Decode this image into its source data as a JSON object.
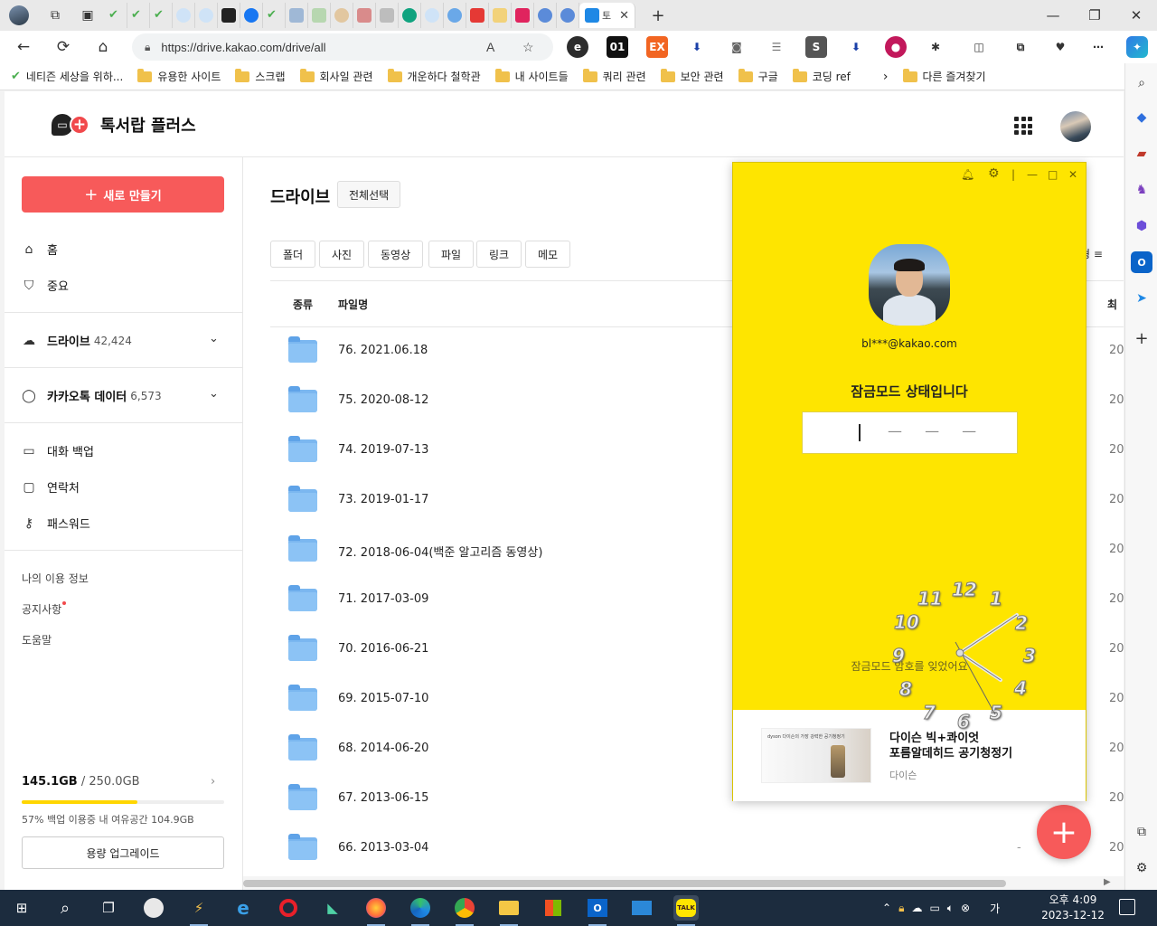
{
  "browser": {
    "active_tab_label": "토",
    "url": "https://drive.kakao.com/drive/all",
    "favorites": [
      "네티즌 세상을 위하...",
      "유용한 사이트",
      "스크랩",
      "회사일 관련",
      "개운하다 철학관",
      "내 사이트들",
      "쿼리 관련",
      "보안 관련",
      "구글",
      "코딩 ref"
    ],
    "other_favorites": "다른 즐겨찾기"
  },
  "header": {
    "logo_text": "톡서랍 플러스"
  },
  "sidebar": {
    "new_button": "새로 만들기",
    "home": "홈",
    "important": "중요",
    "drive": "드라이브",
    "drive_count": "42,424",
    "kakaotalk_data": "카카오톡 데이터",
    "kakaotalk_count": "6,573",
    "chat_backup": "대화 백업",
    "contacts": "연락처",
    "password": "패스워드",
    "my_usage": "나의 이용 정보",
    "notice": "공지사항",
    "help": "도움말",
    "storage_used": "145.1GB",
    "storage_total": "/ 250.0GB",
    "storage_fraction": 0.57,
    "storage_note": "57% 백업 이용중   내 여유공간 104.9GB",
    "upgrade_button": "용량 업그레이드"
  },
  "main": {
    "title": "드라이브",
    "select_all": "전체선택",
    "filters": [
      "폴더",
      "사진",
      "동영상",
      "파일",
      "링크",
      "메모"
    ],
    "sort_label": "형 ≡",
    "col_type": "종류",
    "col_name": "파일명",
    "col_right": "최",
    "rows": [
      {
        "name": "76. 2021.06.18",
        "date": "20"
      },
      {
        "name": "75. 2020-08-12",
        "date": "20"
      },
      {
        "name": "74. 2019-07-13",
        "date": "20"
      },
      {
        "name": "73. 2019-01-17",
        "date": "20"
      },
      {
        "name": "72. 2018-06-04(백준 알고리즘 동영상)",
        "date": "20"
      },
      {
        "name": "71. 2017-03-09",
        "date": "20"
      },
      {
        "name": "70. 2016-06-21",
        "date": "20"
      },
      {
        "name": "69. 2015-07-10",
        "date": "20"
      },
      {
        "name": "68. 2014-06-20",
        "date": "20"
      },
      {
        "name": "67. 2013-06-15",
        "date": "20"
      },
      {
        "name": "66. 2013-03-04",
        "date": "20",
        "dash": "-"
      }
    ]
  },
  "kakao_lock": {
    "email": "bl***@kakao.com",
    "title": "잠금모드 상태입니다",
    "placeholder": "— — —",
    "forgot": "잠금모드 암호를 잊었어요",
    "ad_title_1": "다이슨 빅+콰이엇",
    "ad_title_2": "포름알데히드 공기청정기",
    "ad_source": "다이슨",
    "ad_thumb_text": "dyson 다이슨의 가장 강력한 공기청정기"
  },
  "clock_numbers": [
    "12",
    "1",
    "2",
    "3",
    "4",
    "5",
    "6",
    "7",
    "8",
    "9",
    "10",
    "11"
  ],
  "taskbar": {
    "time": "오후 4:09",
    "date": "2023-12-12",
    "ime": "가"
  },
  "colors": {
    "accent": "#f75a5a",
    "kakao_yellow": "#fee500",
    "storage_bar": "#ffd600",
    "folder": "#8cc3f5"
  }
}
